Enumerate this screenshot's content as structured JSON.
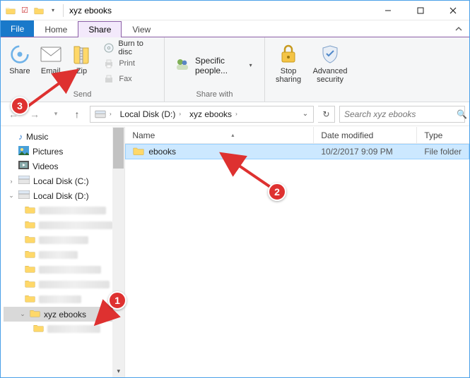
{
  "window": {
    "title": "xyz ebooks"
  },
  "tabs": {
    "file": "File",
    "home": "Home",
    "share": "Share",
    "view": "View"
  },
  "ribbon": {
    "groups": {
      "send": "Send",
      "share_with": "Share with",
      "security": ""
    },
    "share": "Share",
    "email": "Email",
    "zip": "Zip",
    "burn": "Burn to disc",
    "print": "Print",
    "fax": "Fax",
    "specific_people": "Specific people...",
    "stop_sharing": "Stop\nsharing",
    "adv_security": "Advanced\nsecurity"
  },
  "address": {
    "crumbs": [
      "Local Disk (D:)",
      "xyz ebooks"
    ]
  },
  "search": {
    "placeholder": "Search xyz ebooks"
  },
  "columns": {
    "name": "Name",
    "date": "Date modified",
    "type": "Type"
  },
  "rows": [
    {
      "name": "ebooks",
      "date": "10/2/2017 9:09 PM",
      "type": "File folder"
    }
  ],
  "tree": {
    "music": "Music",
    "pictures": "Pictures",
    "videos": "Videos",
    "cdrive": "Local Disk (C:)",
    "ddrive": "Local Disk (D:)",
    "xyz": "xyz ebooks"
  },
  "annotations": {
    "n1": "1",
    "n2": "2",
    "n3": "3"
  }
}
